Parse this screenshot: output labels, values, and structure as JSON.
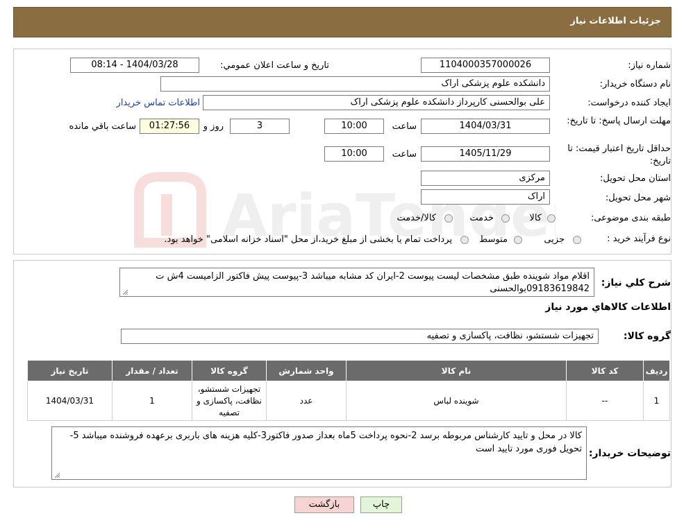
{
  "header": {
    "title": "جزئیات اطلاعات نیاز"
  },
  "form": {
    "need_number": {
      "label": "شماره نیاز:",
      "value": "1104000357000026"
    },
    "announce": {
      "label": "تاریخ و ساعت اعلان عمومي:",
      "value": "1404/03/28 - 08:14"
    },
    "buyer_org": {
      "label": "نام دستگاه خریدار:",
      "value": "دانشکده علوم پزشکی اراک"
    },
    "creator": {
      "label": "ایجاد کننده درخواست:",
      "value": "علی بوالحسنی کارپرداز دانشکده علوم پزشکی اراک",
      "contact_link": "اطلاعات تماس خریدار"
    },
    "reply_deadline": {
      "label": "مهلت ارسال پاسخ: تا تاریخ:",
      "date": "1404/03/31",
      "time_label": "ساعت",
      "time": "10:00",
      "days": "3",
      "days_label": "روز و",
      "remaining": "01:27:56",
      "remaining_label": "ساعت باقي مانده"
    },
    "price_validity": {
      "label": "حداقل تاریخ اعتبار قیمت: تا تاریخ:",
      "date": "1405/11/29",
      "time_label": "ساعت",
      "time": "10:00"
    },
    "province": {
      "label": "استان محل تحویل:",
      "value": "مرکزی"
    },
    "city": {
      "label": "شهر محل تحویل:",
      "value": "اراک"
    },
    "category": {
      "label": "طبقه بندی موضوعی:",
      "options": [
        "کالا",
        "خدمت",
        "کالا/خدمت"
      ]
    },
    "process": {
      "label": "نوع فرآیند خرید :",
      "options": [
        "جزیی",
        "متوسط"
      ],
      "note": "پرداخت تمام یا بخشی از مبلغ خرید،از محل \"اسناد خزانه اسلامی\" خواهد بود."
    }
  },
  "description": {
    "label": "شرح کلي نياز:",
    "text": "اقلام مواد شوینده طبق مشخصات لیست پیوست 2-ایران کد مشابه میباشد 3-پیوست پیش فاکتور الزامیست 4ش ت 09183619842بوالحسنی"
  },
  "goods_info": {
    "title": "اطلاعات کالاهاي مورد نياز",
    "group_label": "گروه کالا:",
    "group_value": "تجهیزات شستشو، نظافت، پاکسازی و تصفیه"
  },
  "table": {
    "headers": [
      "ردیف",
      "کد کالا",
      "نام کالا",
      "واحد شمارش",
      "گروه کالا",
      "تعداد / مقدار",
      "تاریخ نیاز"
    ],
    "rows": [
      {
        "row": "1",
        "code": "--",
        "name": "شوینده لباس",
        "unit": "عدد",
        "group": "تجهیزات شستشو، نظافت، پاکسازی و تصفیه",
        "qty": "1",
        "date": "1404/03/31"
      }
    ]
  },
  "buyer_notes": {
    "label": "توضیحات خریدار:",
    "text": "کالا در محل و تایید کارشناس مربوطه برسد 2-نحوه پرداخت 5ماه بعداز صدور فاکتور3-کلیه هزینه های باربری برعهده فروشنده میباشد 5-تحویل فوری مورد تایید است"
  },
  "buttons": {
    "print": "چاپ",
    "back": "بازگشت"
  },
  "watermark": {
    "text": "AriaTender.neT"
  },
  "colors": {
    "header_bg": "#8b6d42",
    "table_header_bg": "#6b6b6b",
    "back_button_bg": "#f7d4d4",
    "print_button_bg": "#e2f5d8",
    "link": "#1a3ea8"
  }
}
